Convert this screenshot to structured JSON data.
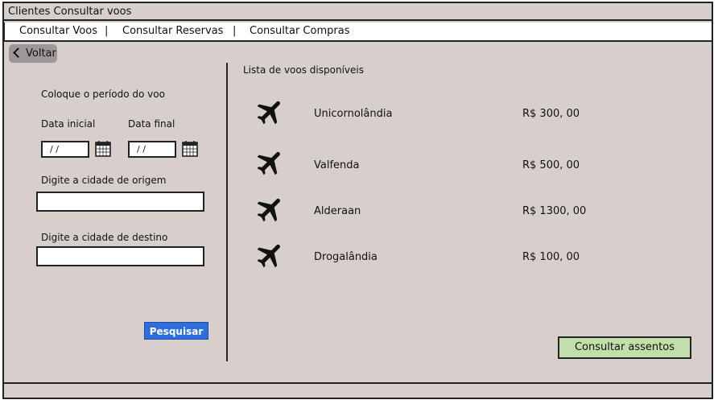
{
  "window": {
    "title": "Clientes Consultar voos"
  },
  "menu": {
    "items": [
      "Consultar Voos",
      "Consultar Reservas",
      "Consultar Compras"
    ],
    "separator": "|"
  },
  "back_button": {
    "label": "Voltar"
  },
  "search_form": {
    "period_label": "Coloque o período do voo",
    "start_date_label": "Data inicial",
    "end_date_label": "Data final",
    "start_date_value": "/ /",
    "end_date_value": "/ /",
    "origin_label": "Digite a cidade de origem",
    "origin_value": "",
    "destination_label": "Digite a cidade de destino",
    "destination_value": "",
    "search_button": "Pesquisar"
  },
  "flights": {
    "title": "Lista de voos disponíveis",
    "items": [
      {
        "destination": "Unicornolândia",
        "price": "R$ 300, 00",
        "icon": "airplane-icon"
      },
      {
        "destination": "Valfenda",
        "price": "R$ 500, 00",
        "icon": "airplane-icon"
      },
      {
        "destination": "Alderaan",
        "price": "R$ 1300, 00",
        "icon": "airplane-icon"
      },
      {
        "destination": "Drogalândia",
        "price": "R$ 100, 00",
        "icon": "airplane-icon"
      }
    ],
    "seats_button": "Consultar assentos"
  },
  "colors": {
    "background": "#d7cfcc",
    "search_button": "#2f6fdc",
    "seats_button": "#c2dea9",
    "back_button": "#9d9897"
  }
}
